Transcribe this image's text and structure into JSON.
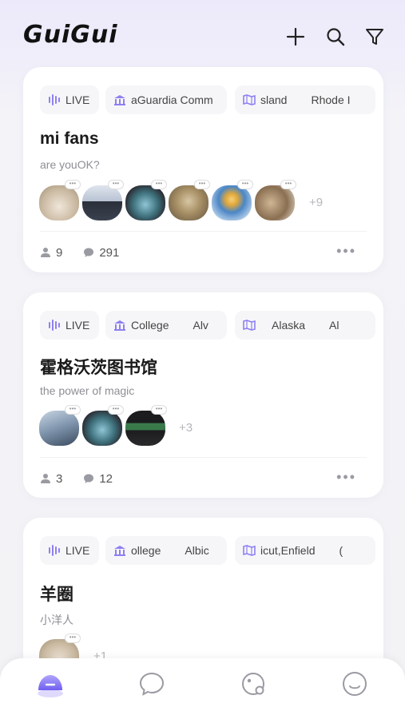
{
  "app": {
    "logo": "GuiGui"
  },
  "header": {
    "icons": [
      "plus-icon",
      "search-icon",
      "filter-icon"
    ]
  },
  "accent": "#7b6cf6",
  "cards": [
    {
      "live_label": "LIVE",
      "school_label": "aGuardia Comm",
      "location_label": "sland",
      "location_label_2": "Rhode I",
      "title": "mi fans",
      "subtitle": "are youOK?",
      "avatar_count": 6,
      "more_count": "+9",
      "members": "9",
      "comments": "291",
      "more": "•••"
    },
    {
      "live_label": "LIVE",
      "school_label": "College",
      "school_label_2": "Alv",
      "location_label": "Alaska",
      "location_label_2": "Al",
      "title": "霍格沃茨图书馆",
      "subtitle": "the power of magic",
      "avatar_count": 3,
      "more_count": "+3",
      "members": "3",
      "comments": "12",
      "more": "•••"
    },
    {
      "live_label": "LIVE",
      "school_label": "ollege",
      "school_label_2": "Albic",
      "location_label": "icut,Enfield",
      "location_label_2": "(",
      "title": "羊圈",
      "subtitle": "小洋人",
      "avatar_count": 1,
      "more_count": "+1"
    }
  ],
  "tabbar": {
    "tabs": [
      "home-icon",
      "chat-bubble-icon",
      "planet-icon",
      "smile-icon"
    ],
    "active_index": 0
  }
}
